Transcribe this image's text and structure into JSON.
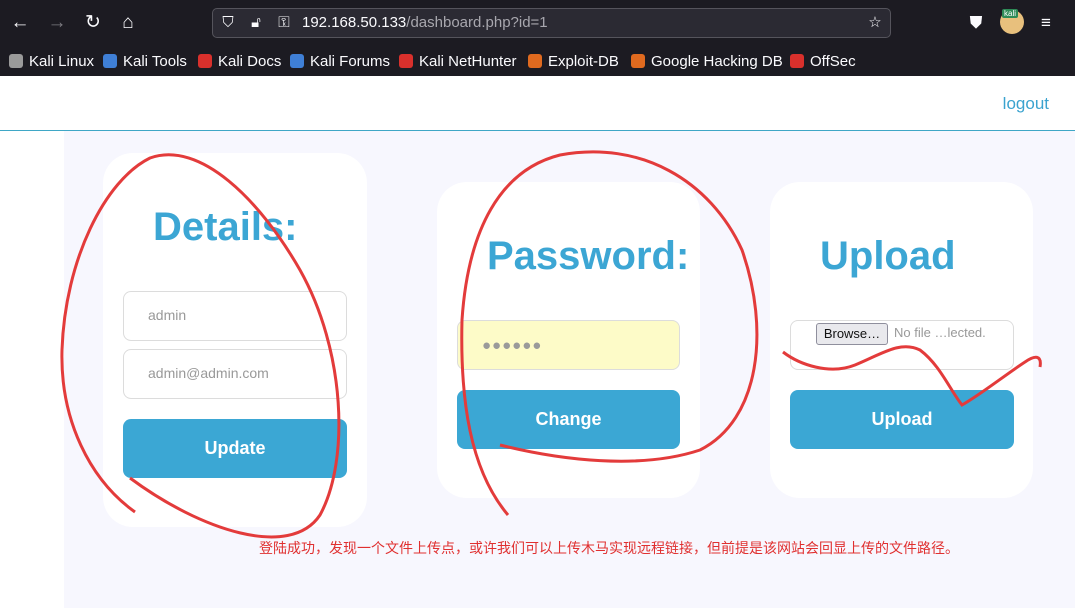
{
  "browser": {
    "url_host": "192.168.50.133",
    "url_path": "/dashboard.php?id=1",
    "avatar_badge": "kali",
    "icons": [
      "back-arrow-icon",
      "forward-arrow-icon",
      "reload-icon",
      "home-icon",
      "shield-icon",
      "lock-icon",
      "key-icon",
      "star-icon",
      "pocket-icon",
      "menu-icon"
    ]
  },
  "bookmarks": [
    {
      "label": "Kali Linux",
      "color": "#9a9a9a"
    },
    {
      "label": "Kali Tools",
      "color": "#3f7fd6"
    },
    {
      "label": "Kali Docs",
      "color": "#d9302c"
    },
    {
      "label": "Kali Forums",
      "color": "#3f7fd6"
    },
    {
      "label": "Kali NetHunter",
      "color": "#d9302c"
    },
    {
      "label": "Exploit-DB",
      "color": "#e06a1f"
    },
    {
      "label": "Google Hacking DB",
      "color": "#e06a1f"
    },
    {
      "label": "OffSec",
      "color": "#d9302c"
    }
  ],
  "header": {
    "logout": "logout"
  },
  "details": {
    "title": "Details:",
    "username_value": "admin",
    "email_value": "admin@admin.com",
    "button": "Update"
  },
  "password": {
    "title": "Password:",
    "masked_value": "●●●●●●",
    "button": "Change"
  },
  "upload": {
    "title": "Upload",
    "browse_label": "Browse…",
    "file_status": "No file …lected.",
    "button": "Upload"
  },
  "annotation": {
    "note": "登陆成功，发现一个文件上传点，或许我们可以上传木马实现远程链接，但前提是该网站会回显上传的文件路径。",
    "color": "#e03030"
  },
  "colors": {
    "accent": "#3ba7d4",
    "browser_bg": "#1c1b22"
  }
}
